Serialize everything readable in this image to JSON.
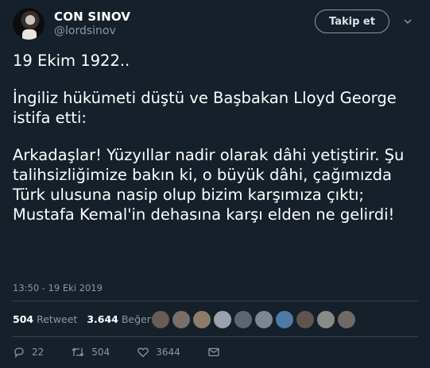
{
  "author": {
    "name": "CON SINOV",
    "handle": "@lordsinov"
  },
  "follow_label": "Takip et",
  "tweet": {
    "paragraphs": [
      "19 Ekim 1922..",
      "İngiliz hükümeti düştü ve Başbakan Lloyd George istifa etti:",
      "Arkadaşlar! Yüzyıllar nadir olarak dâhi yetiştirir. Şu talihsizliğimize bakın ki, o büyük dâhi, çağımızda Türk ulusuna nasip olup bizim karşımıza çıktı; Mustafa Kemal'in dehasına karşı elden ne gelirdi!"
    ],
    "timestamp": "13:50 - 19 Eki 2019"
  },
  "stats": {
    "retweet_count": "504",
    "retweet_label": "Retweet",
    "like_count": "3.644",
    "like_label": "Beğeni"
  },
  "liker_avatars": [
    "#6b5b55",
    "#7a6e66",
    "#8d7c6a",
    "#9aa3ad",
    "#5c6670",
    "#7b8794",
    "#4f7aa6",
    "#5e5450",
    "#8c8a86",
    "#6f6a64"
  ],
  "actions": {
    "reply_count": "22",
    "retweet_count": "504",
    "like_count": "3644"
  },
  "colors": {
    "background": "#15202b",
    "secondary_text": "#8899a6",
    "divider": "#38444d"
  }
}
